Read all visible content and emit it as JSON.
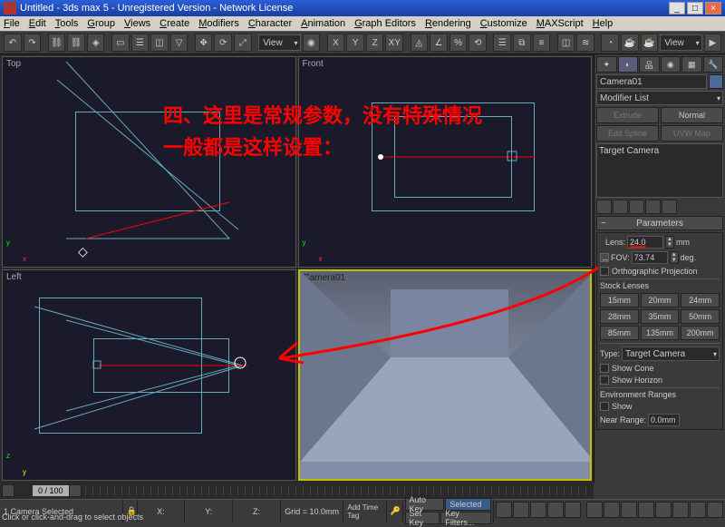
{
  "window": {
    "title": "Untitled - 3ds max 5 - Unregistered Version - Network License",
    "min": "_",
    "max": "□",
    "close": "×"
  },
  "menu": [
    "File",
    "Edit",
    "Tools",
    "Group",
    "Views",
    "Create",
    "Modifiers",
    "Character",
    "Animation",
    "Graph Editors",
    "Rendering",
    "Customize",
    "MAXScript",
    "Help"
  ],
  "toolbar": {
    "view_dd": "View"
  },
  "viewports": {
    "top": "Top",
    "front": "Front",
    "left": "Left",
    "camera": "Camera01"
  },
  "annotation": {
    "line1": "四、这里是常规参数，没有特殊情况",
    "line2": "一般都是这样设置："
  },
  "panel": {
    "object_name": "Camera01",
    "modifier_dd": "Modifier List",
    "normal_btn": "Normal",
    "extrude_btn": "Extrude",
    "edit_spline": "Edit Spline",
    "uvw_btn": "UVW Map",
    "stack_item": "Target Camera",
    "roll_parameters": "Parameters",
    "lens_label": "Lens:",
    "lens_value": "24.0",
    "lens_unit": "mm",
    "fov_label": "FOV:",
    "fov_value": "73.74",
    "fov_unit": "deg.",
    "ortho": "Orthographic Projection",
    "stock_label": "Stock Lenses",
    "lenses": [
      "15mm",
      "20mm",
      "24mm",
      "28mm",
      "35mm",
      "50mm",
      "85mm",
      "135mm",
      "200mm"
    ],
    "type_label": "Type:",
    "type_value": "Target Camera",
    "show_cone": "Show Cone",
    "show_horizon": "Show Horizon",
    "env_label": "Environment Ranges",
    "show": "Show",
    "near_label": "Near Range:",
    "near_val": "0.0mm"
  },
  "time": {
    "slider": "0 / 100"
  },
  "status": {
    "sel": "1 Camera Selected",
    "prompt": "Click or click-and-drag to select objects",
    "x": "X:",
    "y": "Y:",
    "z": "Z:",
    "grid": "Grid = 10.0mm",
    "autokey": "Auto Key",
    "selected": "Selected",
    "setkey": "Set Key",
    "keyfilters": "Key Filters...",
    "addtag": "Add Time Tag"
  }
}
